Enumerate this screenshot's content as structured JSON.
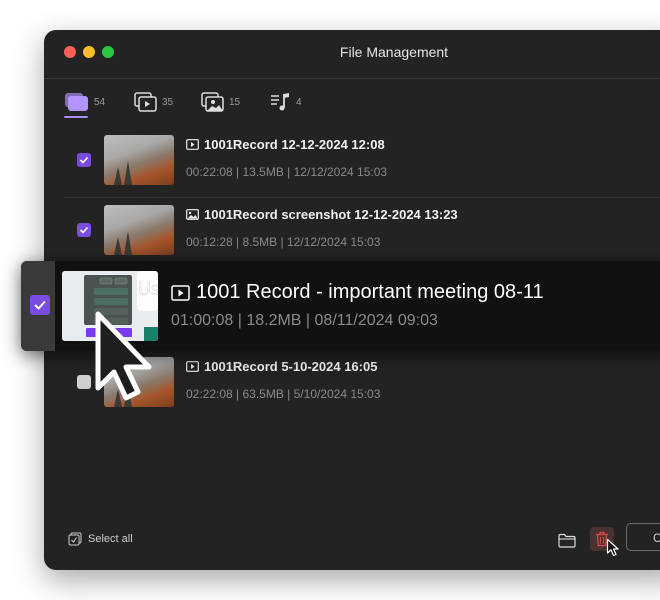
{
  "window": {
    "title": "File Management"
  },
  "tabs": [
    {
      "name": "all",
      "icon": "all-files-icon",
      "count": "54",
      "active": true
    },
    {
      "name": "videos",
      "icon": "video-files-icon",
      "count": "35",
      "active": false
    },
    {
      "name": "images",
      "icon": "image-files-icon",
      "count": "15",
      "active": false
    },
    {
      "name": "audio",
      "icon": "audio-files-icon",
      "count": "4",
      "active": false
    }
  ],
  "files": [
    {
      "type": "video",
      "title": "1001Record 12-12-2024 12:08",
      "meta": "00:22:08 | 13.5MB | 12/12/2024  15:03",
      "checked": true
    },
    {
      "type": "image",
      "title": "1001Record screenshot 12-12-2024 13:23",
      "meta": "00:12:28 | 8.5MB | 12/12/2024  15:03",
      "checked": true
    },
    {
      "type": "video",
      "title": "1001 Record - important meeting 08-11",
      "meta": "01:00:08 | 18.2MB | 08/11/2024  09:03",
      "checked": true,
      "highlighted": true
    },
    {
      "type": "video",
      "title": "1001Record 5-10-2024 16:05",
      "meta": "02:22:08 | 63.5MB | 5/10/2024  15:03",
      "checked": false
    }
  ],
  "thumbnail_preview": {
    "letters": "Us"
  },
  "footer": {
    "select_all_label": "Select all",
    "outline_button_label": "C"
  },
  "colors": {
    "accent": "#7b4ce0",
    "tab_active": "#a98bf5",
    "delete": "#e04848"
  }
}
